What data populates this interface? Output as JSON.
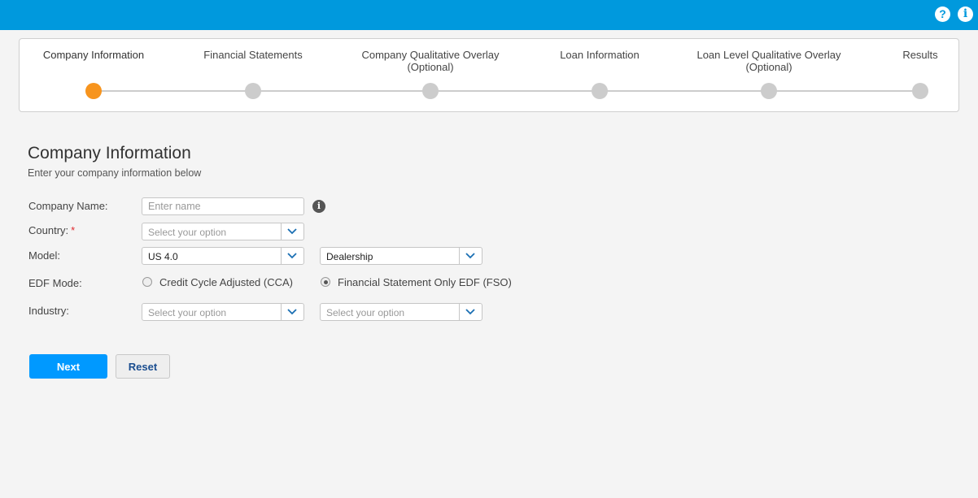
{
  "header": {
    "help_icon": "?",
    "info_icon": "i"
  },
  "stepper": {
    "steps": [
      {
        "label": "Company Information",
        "active": true
      },
      {
        "label": "Financial Statements",
        "active": false
      },
      {
        "label": "Company Qualitative Overlay\n(Optional)",
        "active": false
      },
      {
        "label": "Loan Information",
        "active": false
      },
      {
        "label": "Loan Level Qualitative Overlay\n(Optional)",
        "active": false
      },
      {
        "label": "Results",
        "active": false
      }
    ],
    "active_color": "#f7941d",
    "inactive_color": "#cccccc"
  },
  "page": {
    "title": "Company Information",
    "subtitle": "Enter your company information below"
  },
  "form": {
    "company_name": {
      "label": "Company Name:",
      "placeholder": "Enter name",
      "value": ""
    },
    "country": {
      "label": "Country:",
      "required_mark": "*",
      "selected": "Select your option"
    },
    "model": {
      "label": "Model:",
      "version_selected": "US 4.0",
      "type_selected": "Dealership"
    },
    "edf_mode": {
      "label": "EDF Mode:",
      "options": [
        {
          "label": "Credit Cycle Adjusted (CCA)",
          "checked": false
        },
        {
          "label": "Financial Statement Only EDF (FSO)",
          "checked": true
        }
      ]
    },
    "industry": {
      "label": "Industry:",
      "primary_selected": "Select your option",
      "secondary_selected": "Select your option"
    }
  },
  "actions": {
    "next_label": "Next",
    "reset_label": "Reset"
  },
  "colors": {
    "topbar": "#0099dd",
    "primary_button": "#0099ff",
    "required": "#e0282e"
  }
}
